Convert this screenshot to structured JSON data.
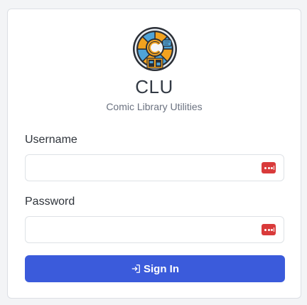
{
  "app": {
    "title": "CLU",
    "subtitle": "Comic Library Utilities",
    "logo_icon": "comic-wheel-logo-icon"
  },
  "form": {
    "username_label": "Username",
    "username_value": "",
    "password_label": "Password",
    "password_value": "",
    "password_manager_icon": "password-manager-dots-icon",
    "submit_label": "Sign In",
    "submit_icon": "sign-in-arrow-icon"
  },
  "colors": {
    "primary": "#3b5bdb",
    "password_manager_badge": "#d93a3a",
    "logo_orange": "#f2a21f",
    "logo_blue": "#4fa4d8"
  }
}
